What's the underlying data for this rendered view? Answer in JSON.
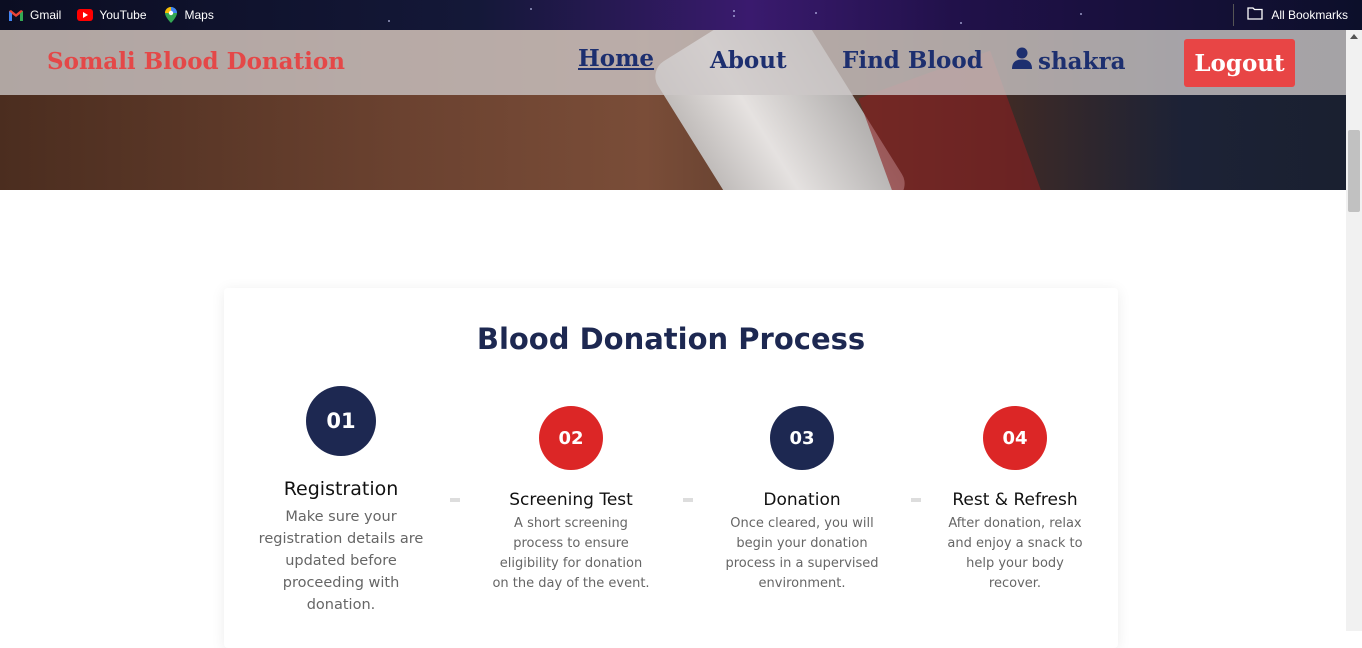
{
  "bookmarks": {
    "items": [
      {
        "label": "Gmail",
        "icon": "gmail-icon"
      },
      {
        "label": "YouTube",
        "icon": "youtube-icon"
      },
      {
        "label": "Maps",
        "icon": "maps-icon"
      }
    ],
    "all_label": "All Bookmarks"
  },
  "nav": {
    "brand": "Somali Blood Donation",
    "links": [
      "Home",
      "About",
      "Find Blood"
    ],
    "user": "shakra",
    "logout": "Logout"
  },
  "process": {
    "title": "Blood Donation Process",
    "steps": [
      {
        "number": "01",
        "title": "Registration",
        "description": "Make sure your registration details are updated before proceeding with donation.",
        "color": "#1d2851"
      },
      {
        "number": "02",
        "title": "Screening Test",
        "description": "A short screening process to ensure eligibility for donation on the day of the event.",
        "color": "#dc2626"
      },
      {
        "number": "03",
        "title": "Donation",
        "description": "Once cleared, you will begin your donation process in a supervised environment.",
        "color": "#1d2851"
      },
      {
        "number": "04",
        "title": "Rest & Refresh",
        "description": "After donation, relax and enjoy a snack to help your body recover.",
        "color": "#dc2626"
      }
    ]
  },
  "colors": {
    "brand_red": "#e44848",
    "nav_blue": "#1d2f6f",
    "logout_bg": "#e84545",
    "title_navy": "#1d2851"
  }
}
